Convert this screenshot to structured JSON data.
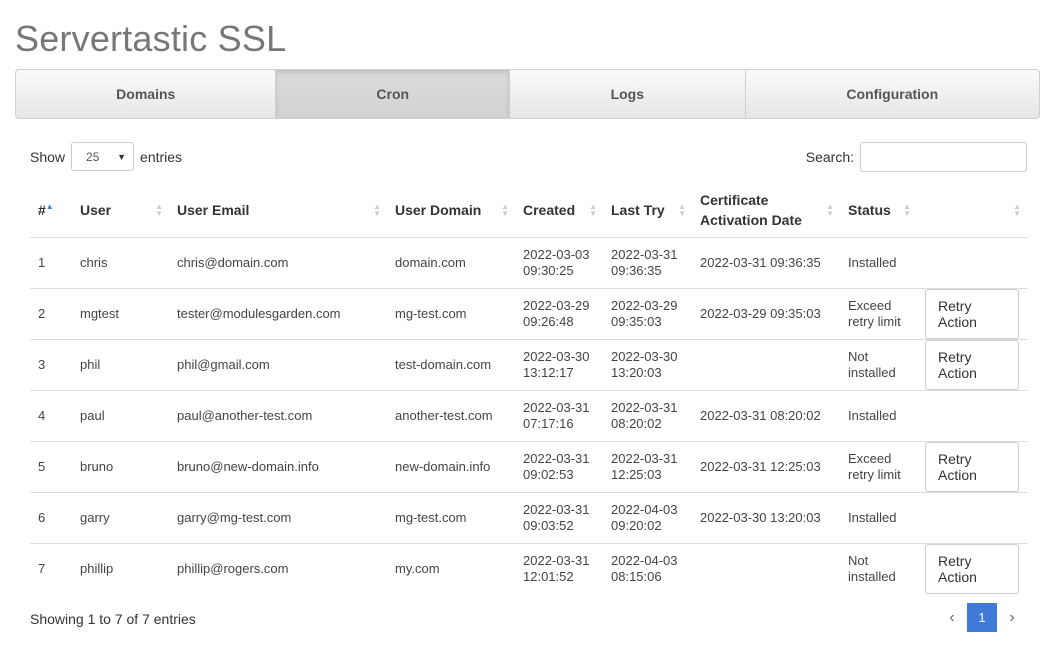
{
  "app": {
    "title": "Servertastic SSL"
  },
  "tabs": [
    {
      "label": "Domains",
      "active": false
    },
    {
      "label": "Cron",
      "active": true
    },
    {
      "label": "Logs",
      "active": false
    },
    {
      "label": "Configuration",
      "active": false
    }
  ],
  "controls": {
    "show_label": "Show",
    "page_size": "25",
    "entries_label": "entries",
    "search_label": "Search:",
    "search_value": ""
  },
  "table": {
    "columns": [
      "#",
      "User",
      "User Email",
      "User Domain",
      "Created",
      "Last Try",
      "Certificate Activation Date",
      "Status",
      ""
    ],
    "rows": [
      {
        "num": "1",
        "user": "chris",
        "email": "chris@domain.com",
        "domain": "domain.com",
        "created": "2022-03-03 09:30:25",
        "last_try": "2022-03-31 09:36:35",
        "activation": "2022-03-31 09:36:35",
        "status": "Installed",
        "action": ""
      },
      {
        "num": "2",
        "user": "mgtest",
        "email": "tester@modulesgarden.com",
        "domain": "mg-test.com",
        "created": "2022-03-29 09:26:48",
        "last_try": "2022-03-29 09:35:03",
        "activation": "2022-03-29 09:35:03",
        "status": "Exceed retry limit",
        "action": "Retry Action"
      },
      {
        "num": "3",
        "user": "phil",
        "email": "phil@gmail.com",
        "domain": "test-domain.com",
        "created": "2022-03-30 13:12:17",
        "last_try": "2022-03-30 13:20:03",
        "activation": "",
        "status": "Not installed",
        "action": "Retry Action"
      },
      {
        "num": "4",
        "user": "paul",
        "email": "paul@another-test.com",
        "domain": "another-test.com",
        "created": "2022-03-31 07:17:16",
        "last_try": "2022-03-31 08:20:02",
        "activation": "2022-03-31 08:20:02",
        "status": "Installed",
        "action": ""
      },
      {
        "num": "5",
        "user": "bruno",
        "email": "bruno@new-domain.info",
        "domain": "new-domain.info",
        "created": "2022-03-31 09:02:53",
        "last_try": "2022-03-31 12:25:03",
        "activation": "2022-03-31 12:25:03",
        "status": "Exceed retry limit",
        "action": "Retry Action"
      },
      {
        "num": "6",
        "user": "garry",
        "email": "garry@mg-test.com",
        "domain": "mg-test.com",
        "created": "2022-03-31 09:03:52",
        "last_try": "2022-04-03 09:20:02",
        "activation": "2022-03-30 13:20:03",
        "status": "Installed",
        "action": ""
      },
      {
        "num": "7",
        "user": "phillip",
        "email": "phillip@rogers.com",
        "domain": "my.com",
        "created": "2022-03-31 12:01:52",
        "last_try": "2022-04-03 08:15:06",
        "activation": "",
        "status": "Not installed",
        "action": "Retry Action"
      }
    ]
  },
  "footer": {
    "info": "Showing 1 to 7 of 7 entries",
    "current_page": "1",
    "prev_icon": "‹",
    "next_icon": "›"
  },
  "colors": {
    "accent": "#3f7ad8",
    "title": "#777777"
  }
}
